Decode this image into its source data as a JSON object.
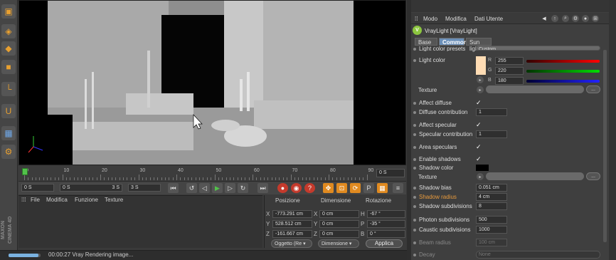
{
  "toolbar": {
    "tools": [
      "cube-tool-icon",
      "cube-mode-icon",
      "cube-solid-icon",
      "cube-orange-icon",
      "corner-tool-icon",
      "magnet-icon",
      "lock-grid-icon",
      "gear-wheel-icon"
    ],
    "brand": "MAXON CINEMA 4D"
  },
  "timeline": {
    "ticks": [
      "0",
      "10",
      "20",
      "30",
      "40",
      "50",
      "60",
      "70",
      "80",
      "90"
    ],
    "current_frame": "0 S"
  },
  "transport": {
    "start_field": "0 S",
    "range_start": "0 S",
    "range_end": "3 S",
    "end_field": "3 S"
  },
  "material_manager": {
    "menu": [
      "File",
      "Modifica",
      "Funzione",
      "Texture"
    ]
  },
  "coordinates": {
    "headers": {
      "pos": "Posizione",
      "dim": "Dimensione",
      "rot": "Rotazione"
    },
    "rows": [
      {
        "axis": "X",
        "pos": "-773.291 cm",
        "dim_axis": "X",
        "dim": "0 cm",
        "rot_axis": "H",
        "rot": "-67 °"
      },
      {
        "axis": "Y",
        "pos": "528.512 cm",
        "dim_axis": "Y",
        "dim": "0 cm",
        "rot_axis": "P",
        "rot": "-35 °"
      },
      {
        "axis": "Z",
        "pos": "-161.667 cm",
        "dim_axis": "Z",
        "dim": "0 cm",
        "rot_axis": "B",
        "rot": "0 °"
      }
    ],
    "mode_dropdown": "Oggetto (Re",
    "size_dropdown": "Dimensione",
    "apply": "Applica"
  },
  "status": {
    "text": "00:00:27 Vray Rendering image...",
    "progress": 0.93
  },
  "attributes": {
    "menu": [
      "Modo",
      "Modifica",
      "Dati Utente"
    ],
    "object_title": "VrayLight [VrayLight]",
    "logo": "V",
    "tabs": [
      "Base",
      "Common",
      "Sun light"
    ],
    "active_tab": "Common",
    "partial_row_label": "Light color presets",
    "partial_row_value": "Custom",
    "light_color_label": "Light color",
    "rgb": {
      "r_label": "R",
      "r": "255",
      "g_label": "G",
      "g": "220",
      "b_label": "B",
      "b": "180"
    },
    "color_hex": "#ffdcb4",
    "texture_label": "Texture",
    "dots": "...",
    "affect_diffuse": "Affect diffuse",
    "diffuse_contribution": "Diffuse contribution",
    "diffuse_contribution_value": "1",
    "affect_specular": "Affect specular",
    "specular_contribution": "Specular contribution",
    "specular_contribution_value": "1",
    "area_speculars": "Area speculars",
    "enable_shadows": "Enable shadows",
    "shadow_color": "Shadow color",
    "texture2_label": "Texture",
    "shadow_bias": "Shadow bias",
    "shadow_bias_value": "0.051 cm",
    "shadow_radius": "Shadow radius",
    "shadow_radius_value": "4 cm",
    "shadow_subdivisions": "Shadow subdivisions",
    "shadow_subdivisions_value": "8",
    "photon_subdivisions": "Photon subdivisions",
    "photon_subdivisions_value": "500",
    "caustic_subdivisions": "Caustic subdivisions",
    "caustic_subdivisions_value": "1000",
    "beam_radius": "Beam radius",
    "beam_radius_value": "100 cm",
    "decay": "Decay",
    "decay_value": "None",
    "checkmark": "✓"
  }
}
